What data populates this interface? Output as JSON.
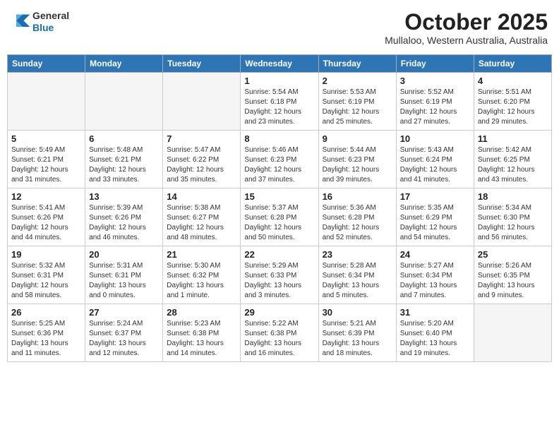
{
  "header": {
    "logo": {
      "general": "General",
      "blue": "Blue"
    },
    "month": "October 2025",
    "location": "Mullaloo, Western Australia, Australia"
  },
  "weekdays": [
    "Sunday",
    "Monday",
    "Tuesday",
    "Wednesday",
    "Thursday",
    "Friday",
    "Saturday"
  ],
  "weeks": [
    [
      {
        "day": "",
        "empty": true
      },
      {
        "day": "",
        "empty": true
      },
      {
        "day": "",
        "empty": true
      },
      {
        "day": "1",
        "info": "Sunrise: 5:54 AM\nSunset: 6:18 PM\nDaylight: 12 hours\nand 23 minutes."
      },
      {
        "day": "2",
        "info": "Sunrise: 5:53 AM\nSunset: 6:19 PM\nDaylight: 12 hours\nand 25 minutes."
      },
      {
        "day": "3",
        "info": "Sunrise: 5:52 AM\nSunset: 6:19 PM\nDaylight: 12 hours\nand 27 minutes."
      },
      {
        "day": "4",
        "info": "Sunrise: 5:51 AM\nSunset: 6:20 PM\nDaylight: 12 hours\nand 29 minutes."
      }
    ],
    [
      {
        "day": "5",
        "info": "Sunrise: 5:49 AM\nSunset: 6:21 PM\nDaylight: 12 hours\nand 31 minutes."
      },
      {
        "day": "6",
        "info": "Sunrise: 5:48 AM\nSunset: 6:21 PM\nDaylight: 12 hours\nand 33 minutes."
      },
      {
        "day": "7",
        "info": "Sunrise: 5:47 AM\nSunset: 6:22 PM\nDaylight: 12 hours\nand 35 minutes."
      },
      {
        "day": "8",
        "info": "Sunrise: 5:46 AM\nSunset: 6:23 PM\nDaylight: 12 hours\nand 37 minutes."
      },
      {
        "day": "9",
        "info": "Sunrise: 5:44 AM\nSunset: 6:23 PM\nDaylight: 12 hours\nand 39 minutes."
      },
      {
        "day": "10",
        "info": "Sunrise: 5:43 AM\nSunset: 6:24 PM\nDaylight: 12 hours\nand 41 minutes."
      },
      {
        "day": "11",
        "info": "Sunrise: 5:42 AM\nSunset: 6:25 PM\nDaylight: 12 hours\nand 43 minutes."
      }
    ],
    [
      {
        "day": "12",
        "info": "Sunrise: 5:41 AM\nSunset: 6:26 PM\nDaylight: 12 hours\nand 44 minutes."
      },
      {
        "day": "13",
        "info": "Sunrise: 5:39 AM\nSunset: 6:26 PM\nDaylight: 12 hours\nand 46 minutes."
      },
      {
        "day": "14",
        "info": "Sunrise: 5:38 AM\nSunset: 6:27 PM\nDaylight: 12 hours\nand 48 minutes."
      },
      {
        "day": "15",
        "info": "Sunrise: 5:37 AM\nSunset: 6:28 PM\nDaylight: 12 hours\nand 50 minutes."
      },
      {
        "day": "16",
        "info": "Sunrise: 5:36 AM\nSunset: 6:28 PM\nDaylight: 12 hours\nand 52 minutes."
      },
      {
        "day": "17",
        "info": "Sunrise: 5:35 AM\nSunset: 6:29 PM\nDaylight: 12 hours\nand 54 minutes."
      },
      {
        "day": "18",
        "info": "Sunrise: 5:34 AM\nSunset: 6:30 PM\nDaylight: 12 hours\nand 56 minutes."
      }
    ],
    [
      {
        "day": "19",
        "info": "Sunrise: 5:32 AM\nSunset: 6:31 PM\nDaylight: 12 hours\nand 58 minutes."
      },
      {
        "day": "20",
        "info": "Sunrise: 5:31 AM\nSunset: 6:31 PM\nDaylight: 13 hours\nand 0 minutes."
      },
      {
        "day": "21",
        "info": "Sunrise: 5:30 AM\nSunset: 6:32 PM\nDaylight: 13 hours\nand 1 minute."
      },
      {
        "day": "22",
        "info": "Sunrise: 5:29 AM\nSunset: 6:33 PM\nDaylight: 13 hours\nand 3 minutes."
      },
      {
        "day": "23",
        "info": "Sunrise: 5:28 AM\nSunset: 6:34 PM\nDaylight: 13 hours\nand 5 minutes."
      },
      {
        "day": "24",
        "info": "Sunrise: 5:27 AM\nSunset: 6:34 PM\nDaylight: 13 hours\nand 7 minutes."
      },
      {
        "day": "25",
        "info": "Sunrise: 5:26 AM\nSunset: 6:35 PM\nDaylight: 13 hours\nand 9 minutes."
      }
    ],
    [
      {
        "day": "26",
        "info": "Sunrise: 5:25 AM\nSunset: 6:36 PM\nDaylight: 13 hours\nand 11 minutes."
      },
      {
        "day": "27",
        "info": "Sunrise: 5:24 AM\nSunset: 6:37 PM\nDaylight: 13 hours\nand 12 minutes."
      },
      {
        "day": "28",
        "info": "Sunrise: 5:23 AM\nSunset: 6:38 PM\nDaylight: 13 hours\nand 14 minutes."
      },
      {
        "day": "29",
        "info": "Sunrise: 5:22 AM\nSunset: 6:38 PM\nDaylight: 13 hours\nand 16 minutes."
      },
      {
        "day": "30",
        "info": "Sunrise: 5:21 AM\nSunset: 6:39 PM\nDaylight: 13 hours\nand 18 minutes."
      },
      {
        "day": "31",
        "info": "Sunrise: 5:20 AM\nSunset: 6:40 PM\nDaylight: 13 hours\nand 19 minutes."
      },
      {
        "day": "",
        "empty": true
      }
    ]
  ]
}
